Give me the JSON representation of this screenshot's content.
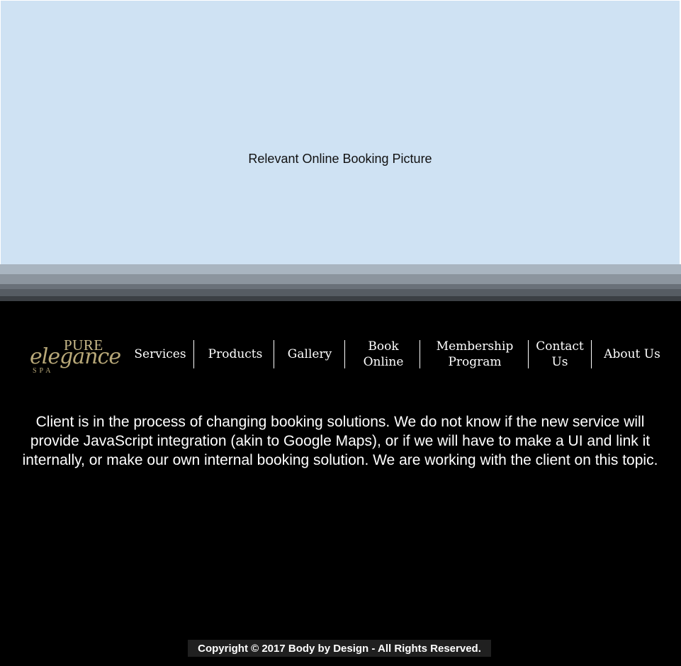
{
  "hero": {
    "caption": "Relevant Online Booking Picture",
    "background_color": "#cfe2f3"
  },
  "logo": {
    "line1": "PURE",
    "line2": "elegance",
    "line3": "SPA",
    "color": "#b8a878"
  },
  "nav": {
    "items": [
      {
        "label": "Services"
      },
      {
        "label": "Products"
      },
      {
        "label": "Gallery"
      },
      {
        "label": "Book\nOnline"
      },
      {
        "label": "Membership\nProgram"
      },
      {
        "label": "Contact\nUs"
      },
      {
        "label": "About Us"
      }
    ]
  },
  "main": {
    "message": "Client is in the process of changing booking solutions. We do not know if the new service will provide JavaScript integration (akin to Google Maps), or if we will have to make a UI and link it internally, or make our own internal booking solution. We are working with the client on this topic."
  },
  "footer": {
    "copyright": "Copyright © 2017 Body by Design - All Rights Reserved."
  }
}
